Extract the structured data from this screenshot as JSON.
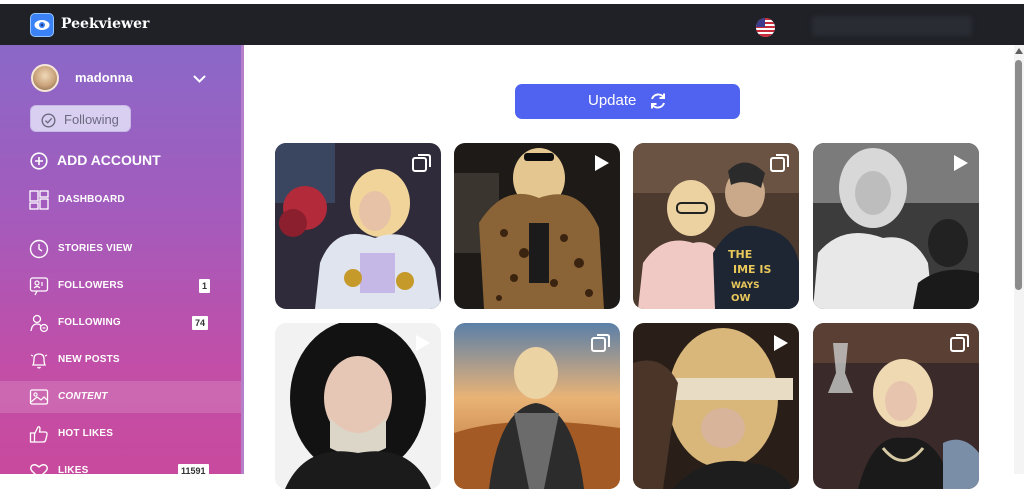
{
  "app": {
    "title": "Peekviewer",
    "icon": "eye-icon"
  },
  "header": {
    "language_flag": "us-flag-icon"
  },
  "profile": {
    "name": "madonna",
    "follow_label": "Following",
    "add_account_label": "ADD ACCOUNT"
  },
  "sidebar": {
    "items": [
      {
        "label": "DASHBOARD",
        "icon": "dashboard-grid-icon"
      },
      {
        "label": "STORIES VIEW",
        "icon": "clock-icon"
      },
      {
        "label": "FOLLOWERS",
        "icon": "followers-icon",
        "count": "1"
      },
      {
        "label": "FOLLOWING",
        "icon": "following-icon",
        "count": "74"
      },
      {
        "label": "NEW POSTS",
        "icon": "bell-icon"
      },
      {
        "label": "CONTENT",
        "icon": "image-icon",
        "active": true
      },
      {
        "label": "HOT LIKES",
        "icon": "thumbs-up-icon"
      },
      {
        "label": "LIKES",
        "icon": "heart-icon",
        "count": "11591"
      }
    ]
  },
  "main": {
    "update_label": "Update",
    "posts": [
      {
        "type": "carousel",
        "icon": "carousel-icon"
      },
      {
        "type": "video",
        "icon": "play-icon"
      },
      {
        "type": "carousel",
        "icon": "carousel-icon"
      },
      {
        "type": "video",
        "icon": "play-icon"
      },
      {
        "type": "video",
        "icon": "play-icon"
      },
      {
        "type": "carousel",
        "icon": "carousel-icon"
      },
      {
        "type": "video",
        "icon": "play-icon"
      },
      {
        "type": "carousel",
        "icon": "carousel-icon"
      }
    ]
  },
  "colors": {
    "accent": "#4f63f0",
    "header": "#1f2127",
    "sidebar_top": "#8a68c8",
    "sidebar_bottom": "#c84a9e"
  }
}
